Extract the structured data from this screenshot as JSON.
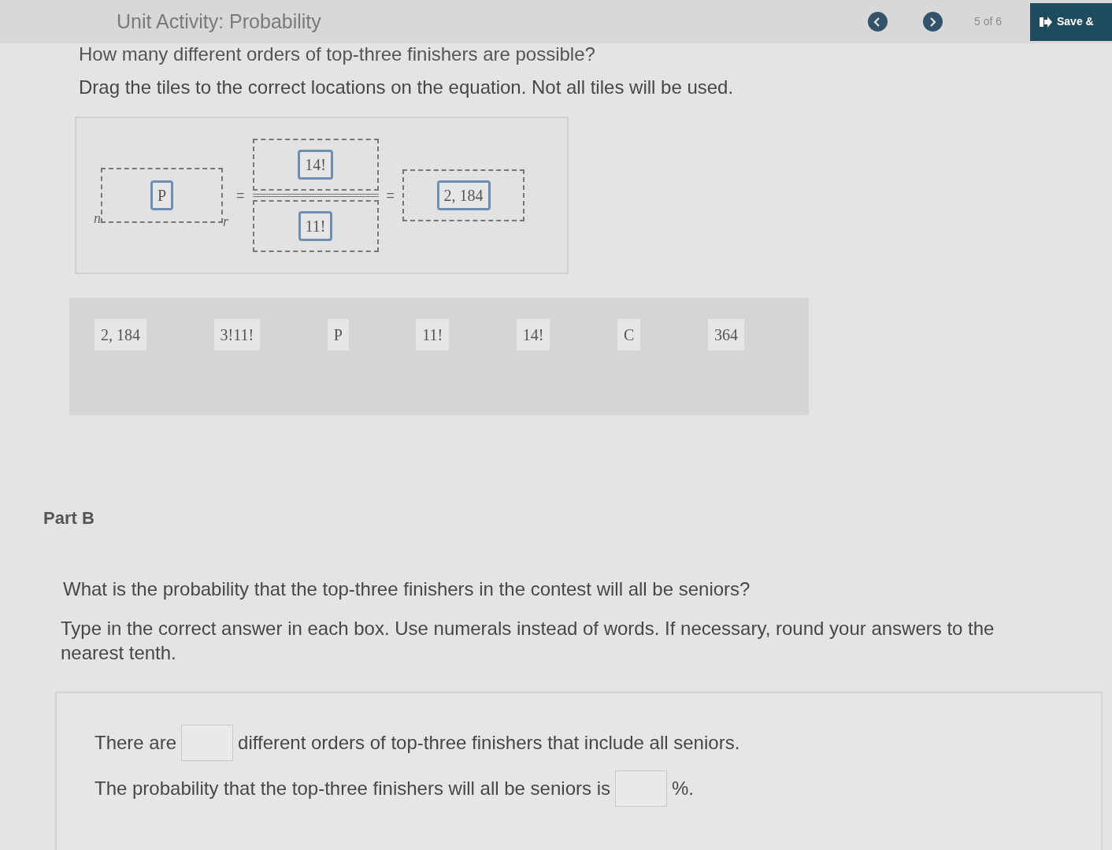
{
  "header": {
    "title": "Unit Activity: Probability",
    "page_indicator": "5 of 6",
    "save_button": "Save &"
  },
  "part_a": {
    "question": "How many different orders of top-three finishers are possible?",
    "instructions": "Drag the tiles to the correct locations on the equation. Not all tiles will be used.",
    "equation": [
      {
        "kind": "notation",
        "left_index": "n",
        "tile": "P",
        "right_index": "r"
      },
      {
        "kind": "operator",
        "text": "="
      },
      {
        "kind": "fraction",
        "numerator": "14!",
        "denominator": "11!"
      },
      {
        "kind": "operator",
        "text": "="
      },
      {
        "kind": "slot",
        "tile": "2, 184"
      }
    ],
    "tile_bank": [
      "2, 184",
      "3!11!",
      "P",
      "11!",
      "14!",
      "C",
      "364"
    ]
  },
  "part_b": {
    "heading": "Part B",
    "question": "What is the probability that the top-three finishers in the contest will all be seniors?",
    "instructions": "Type in the correct answer in each box. Use numerals instead of words. If necessary, round your answers to the nearest tenth.",
    "answers": [
      {
        "before": "There are",
        "after": "different orders of top-three finishers that include all seniors."
      },
      {
        "before": "The probability that the top-three finishers will all be seniors is",
        "after": "%."
      }
    ]
  }
}
